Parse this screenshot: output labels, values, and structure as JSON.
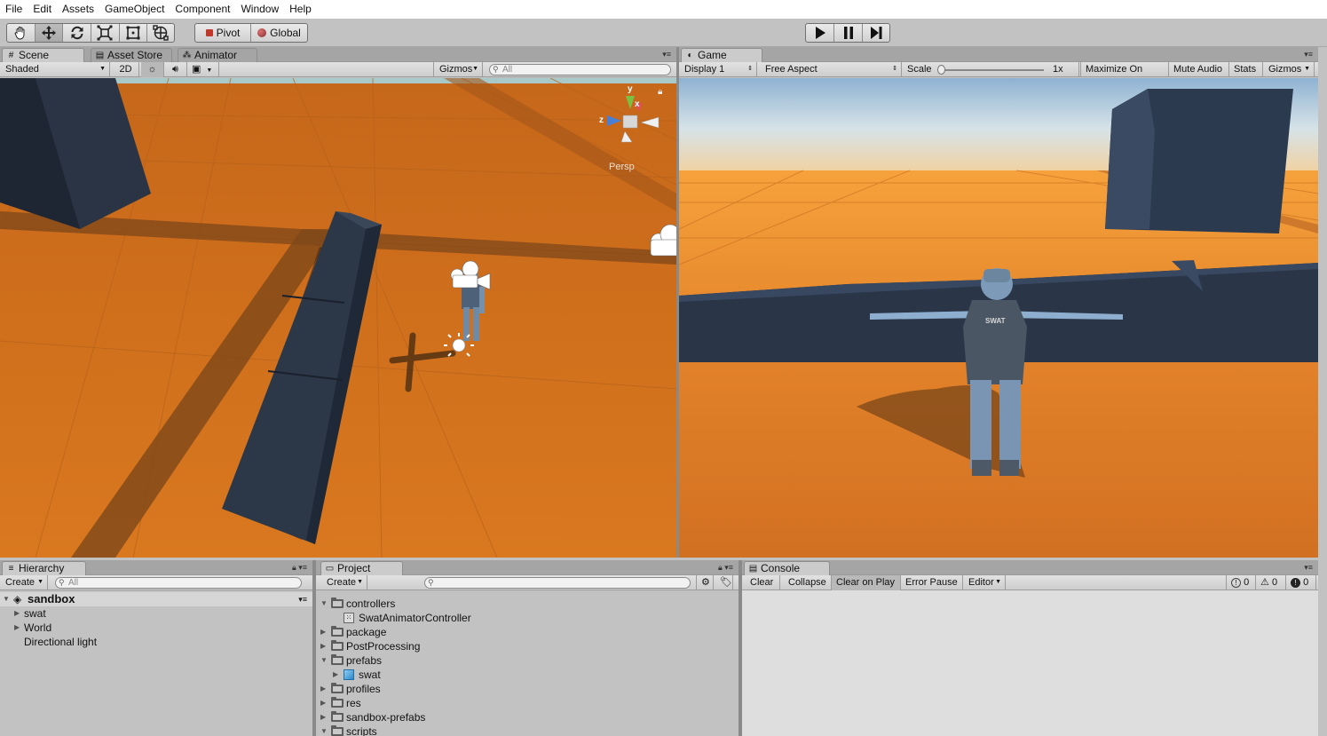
{
  "menu": [
    "File",
    "Edit",
    "Assets",
    "GameObject",
    "Component",
    "Window",
    "Help"
  ],
  "toolbar": {
    "tools": [
      "hand-tool-icon",
      "move-tool-icon",
      "rotate-tool-icon",
      "scale-tool-icon",
      "rect-tool-icon",
      "transform-tool-icon"
    ],
    "pivot_label": "Pivot",
    "global_label": "Global"
  },
  "scene_panel": {
    "tabs": [
      "Scene",
      "Asset Store",
      "Animator"
    ],
    "shading_mode": "Shaded",
    "mode_2d": "2D",
    "gizmos_label": "Gizmos",
    "search_placeholder": "All",
    "persp_label": "Persp",
    "axis_labels": {
      "y": "y",
      "x": "x",
      "z": "z"
    }
  },
  "game_panel": {
    "tab": "Game",
    "display": "Display 1",
    "aspect": "Free Aspect",
    "scale_label": "Scale",
    "scale_value": "1x",
    "buttons": [
      "Maximize On Play",
      "Mute Audio",
      "Stats",
      "Gizmos"
    ],
    "vest_text": "SWAT"
  },
  "hierarchy": {
    "tab": "Hierarchy",
    "create_label": "Create",
    "search_placeholder": "All",
    "scene_name": "sandbox",
    "items": [
      "swat",
      "World",
      "Directional light"
    ]
  },
  "project": {
    "tab": "Project",
    "create_label": "Create",
    "items": [
      {
        "name": "controllers",
        "depth": 0,
        "expanded": true,
        "type": "folder"
      },
      {
        "name": "SwatAnimatorController",
        "depth": 1,
        "expanded": false,
        "type": "controller"
      },
      {
        "name": "package",
        "depth": 0,
        "expanded": false,
        "type": "folder"
      },
      {
        "name": "PostProcessing",
        "depth": 0,
        "expanded": false,
        "type": "folder"
      },
      {
        "name": "prefabs",
        "depth": 0,
        "expanded": true,
        "type": "folder"
      },
      {
        "name": "swat",
        "depth": 1,
        "expanded": false,
        "type": "prefab"
      },
      {
        "name": "profiles",
        "depth": 0,
        "expanded": false,
        "type": "folder"
      },
      {
        "name": "res",
        "depth": 0,
        "expanded": false,
        "type": "folder"
      },
      {
        "name": "sandbox-prefabs",
        "depth": 0,
        "expanded": false,
        "type": "folder"
      },
      {
        "name": "scripts",
        "depth": 0,
        "expanded": true,
        "type": "folder"
      }
    ]
  },
  "console": {
    "tab": "Console",
    "buttons": [
      "Clear",
      "Collapse",
      "Clear on Play",
      "Error Pause",
      "Editor"
    ],
    "log_count": "0",
    "warning_count": "0",
    "error_count": "0"
  },
  "colors": {
    "ground": "#d4741e",
    "wall": "#2a3444",
    "sky_top": "#8fb2d2",
    "sky_horizon": "#e8c08a"
  }
}
